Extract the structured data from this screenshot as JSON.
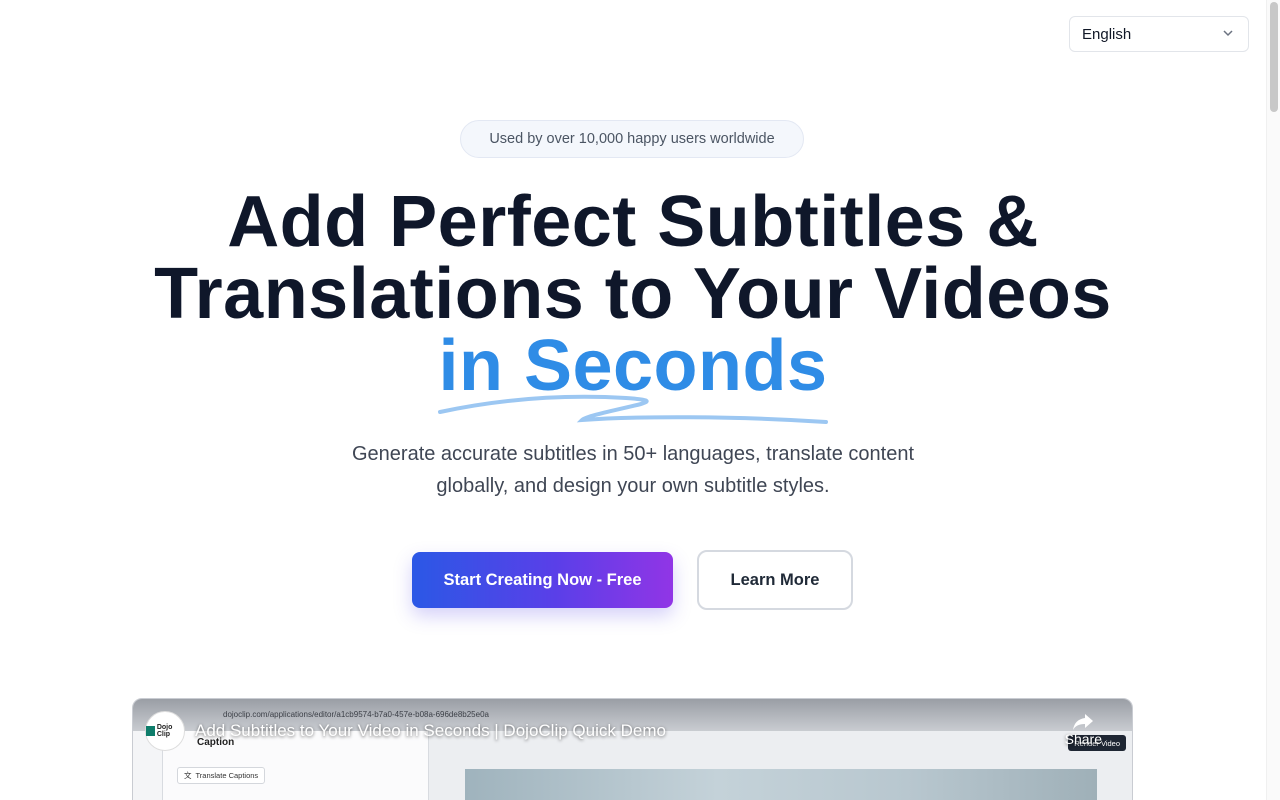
{
  "language_select": {
    "value": "English"
  },
  "hero": {
    "badge": "Used by over 10,000 happy users worldwide",
    "headline_line1": "Add Perfect Subtitles &",
    "headline_line2": "Translations to Your Videos",
    "headline_accent": "in Seconds",
    "subtext_line1": "Generate accurate subtitles in 50+ languages, translate content",
    "subtext_line2": "globally, and design your own subtitle styles.",
    "primary_cta": "Start Creating Now - Free",
    "secondary_cta": "Learn More"
  },
  "video": {
    "title": "Add Subtitles to Your Video in Seconds | DojoClip Quick Demo",
    "channel_logo_text": "Dojo Clip",
    "share_label": "Share",
    "url": "dojoclip.com/applications/editor/a1cb9574-b7a0-457e-b08a-696de8b25e0a",
    "panel_title": "Caption",
    "translate_chip": "Translate Captions",
    "render_label": "Render Video"
  },
  "colors": {
    "accent": "#2f8ce6",
    "heading": "#0f172a",
    "gradient_start": "#2b58e6",
    "gradient_end": "#9135e6"
  }
}
